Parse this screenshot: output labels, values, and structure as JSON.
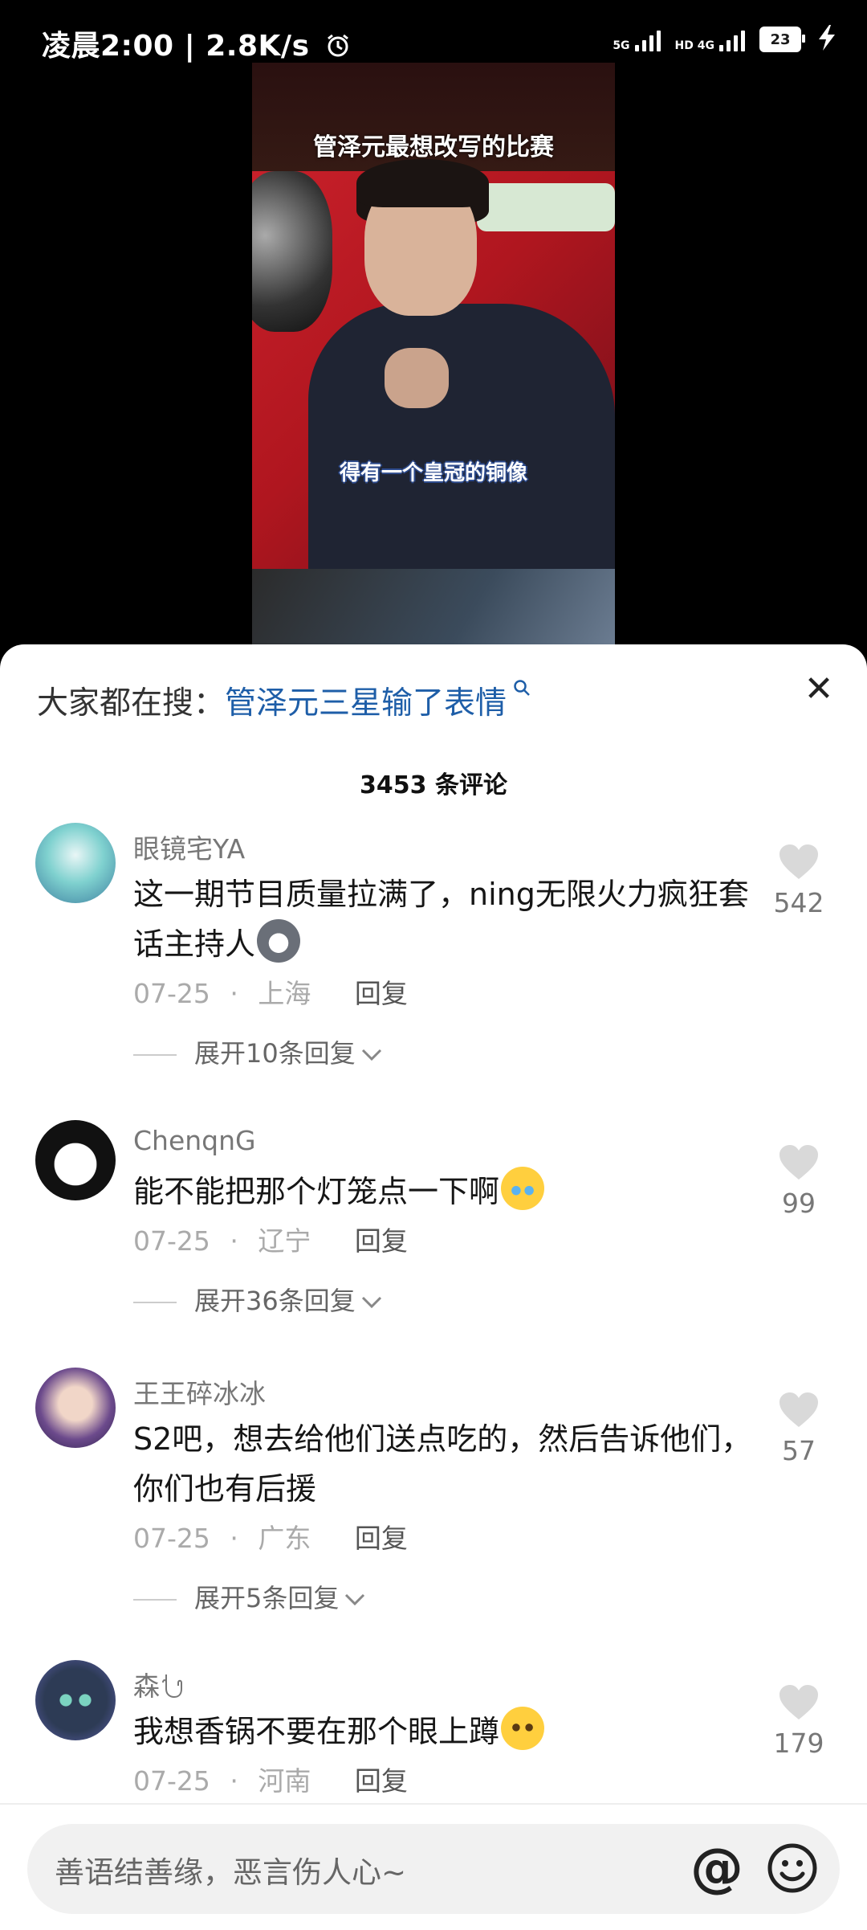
{
  "status_bar": {
    "time": "凌晨2:00 | 2.8K/s",
    "alarm_icon": "alarm-clock-icon",
    "net1": "5G",
    "net2": "HD 4G",
    "battery": "23",
    "charging_icon": "lightning-icon"
  },
  "video": {
    "title": "管泽元最想改写的比赛",
    "subtitle": "得有一个皇冠的铜像"
  },
  "search_suggestion": {
    "prefix": "大家都在搜：",
    "query": "管泽元三星输了表情"
  },
  "comment_count": "3453 条评论",
  "comments": [
    {
      "name": "眼镜宅YA",
      "text": "这一期节目质量拉满了，ning无限火力疯狂套话主持人",
      "date": "07-25",
      "location": "上海",
      "reply": "回复",
      "expand": "展开10条回复",
      "likes": "542"
    },
    {
      "name": "ChenqnG",
      "text": "能不能把那个灯笼点一下啊",
      "date": "07-25",
      "location": "辽宁",
      "reply": "回复",
      "expand": "展开36条回复",
      "likes": "99"
    },
    {
      "name": "王王碎冰冰",
      "text": "S2吧，想去给他们送点吃的，然后告诉他们，你们也有后援",
      "date": "07-25",
      "location": "广东",
      "reply": "回复",
      "expand": "展开5条回复",
      "likes": "57"
    },
    {
      "name": "森",
      "text": "我想香锅不要在那个眼上蹲",
      "date": "07-25",
      "location": "河南",
      "reply": "回复",
      "likes": "179"
    }
  ],
  "input": {
    "placeholder": "善语结善缘，恶言伤人心~",
    "at_symbol": "@"
  },
  "meta_separator": "·",
  "close_symbol": "✕",
  "chevron_symbol": "⌄"
}
